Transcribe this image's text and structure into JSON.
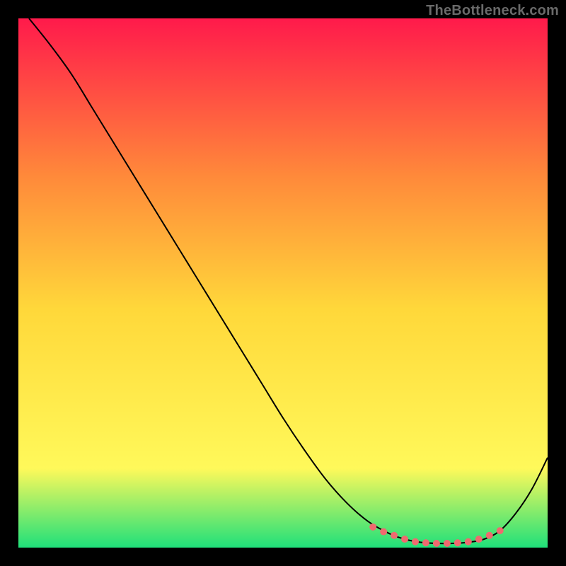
{
  "watermark": "TheBottleneck.com",
  "chart_data": {
    "type": "line",
    "title": "",
    "xlabel": "",
    "ylabel": "",
    "xlim": [
      0,
      100
    ],
    "ylim": [
      0,
      100
    ],
    "grid": false,
    "legend": false,
    "background_gradient": {
      "top": "#ff1a4b",
      "mid_upper": "#ff8a3a",
      "mid": "#ffd83a",
      "mid_lower": "#fff95a",
      "bottom": "#1fe07a"
    },
    "series": [
      {
        "name": "bottleneck-curve",
        "stroke": "#000000",
        "stroke_width": 2,
        "x": [
          2,
          6,
          10,
          14,
          18,
          22,
          26,
          30,
          34,
          38,
          42,
          46,
          50,
          54,
          58,
          62,
          66,
          70,
          73,
          76,
          79,
          82,
          85,
          88,
          91,
          94,
          97,
          100
        ],
        "y": [
          100,
          95,
          89.5,
          83,
          76.5,
          70,
          63.5,
          57,
          50.5,
          44,
          37.5,
          31,
          24.5,
          18.5,
          13,
          8.5,
          5,
          2.7,
          1.6,
          1.0,
          0.8,
          0.8,
          1.0,
          1.6,
          3.2,
          6.5,
          11,
          17
        ]
      }
    ],
    "markers": {
      "name": "trough-dots",
      "color": "#ef6a6f",
      "radius": 5,
      "x": [
        67,
        69,
        71,
        73,
        75,
        77,
        79,
        81,
        83,
        85,
        87,
        89,
        91
      ],
      "y": [
        3.9,
        3.0,
        2.3,
        1.6,
        1.1,
        0.9,
        0.8,
        0.8,
        0.9,
        1.1,
        1.6,
        2.3,
        3.2
      ]
    }
  }
}
